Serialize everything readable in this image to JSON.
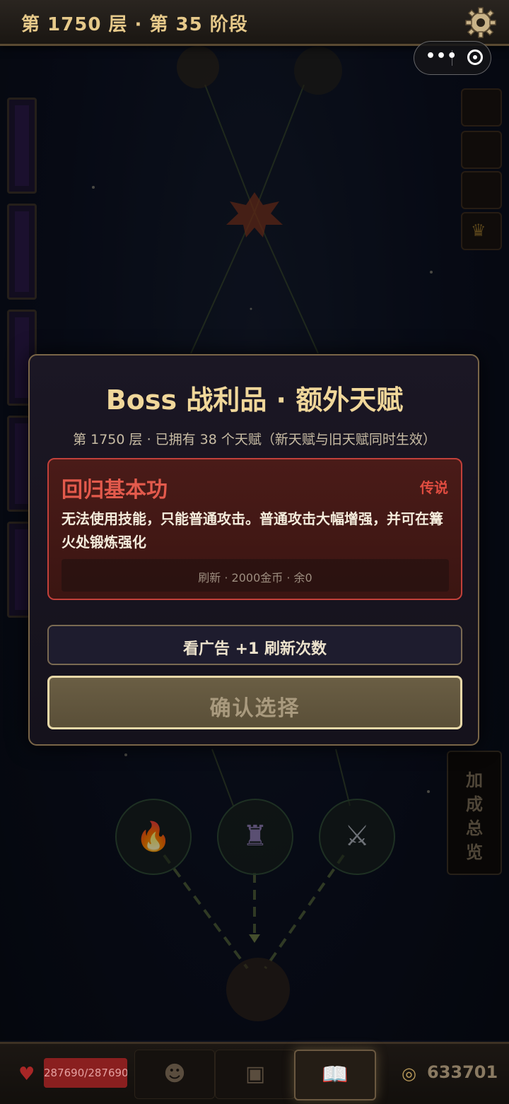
{
  "header": {
    "level_title": "第 1750 层 · 第 35 阶段"
  },
  "miniprogram_capsule": {
    "menu_glyph": "•••",
    "close_glyph": "◉"
  },
  "overview": {
    "chars": [
      "加",
      "成",
      "总",
      "览"
    ]
  },
  "modal": {
    "title": "Boss 战利品 · 额外天赋",
    "subtitle": "第 1750 层 · 已拥有 38 个天赋（新天赋与旧天赋同时生效）",
    "talent": {
      "name": "回归基本功",
      "rarity": "传说",
      "description": "无法使用技能，只能普通攻击。普通攻击大幅增强，并可在篝火处锻炼强化",
      "refresh_text": "刷新 · 2000金币 · 余0"
    },
    "ad_button_label": "看广告 +1 刷新次数",
    "confirm_button_label": "确认选择"
  },
  "bottom_bar": {
    "hp_text": "287690/287690",
    "hp_fraction": 1.0,
    "gold": "633701"
  },
  "colors": {
    "legendary": "#e04c40",
    "gold_title": "#f0d79a",
    "background": "#0b0f1a"
  },
  "icons": {
    "settings": "gear-icon",
    "heart": "heart-icon",
    "coin": "coin-icon",
    "hero_tab": "hero-icon",
    "bag_tab": "backpack-icon",
    "book_tab": "book-icon"
  }
}
